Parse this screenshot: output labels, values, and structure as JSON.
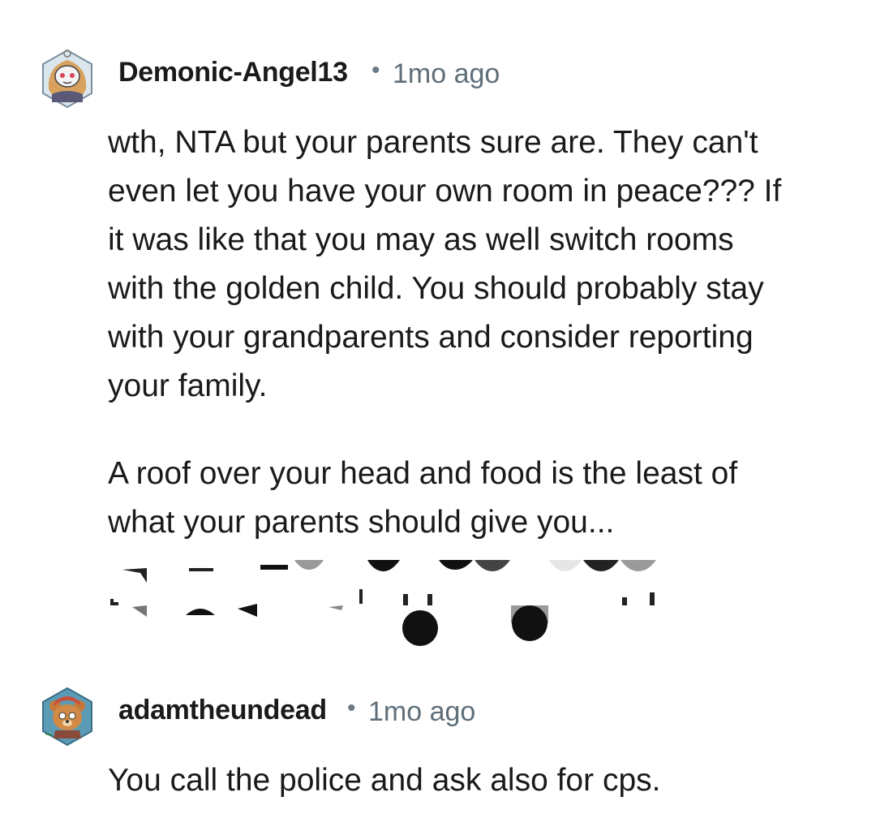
{
  "comments": [
    {
      "username": "Demonic-Angel13",
      "separator": "•",
      "timestamp": "1mo ago",
      "avatar_icon": "snoo-avatar-icon",
      "paragraphs": [
        "wth, NTA but your parents sure are. They can't\neven let you have your own room in peace??? If\nit was like that you may as well switch rooms\nwith the golden child. You should probably stay\nwith your grandparents and consider reporting\nyour family.",
        "A roof over your head and food is the least of\nwhat your parents should give you..."
      ]
    },
    {
      "username": "adamtheundead",
      "separator": "•",
      "timestamp": "1mo ago",
      "avatar_icon": "bear-avatar-icon",
      "paragraphs": [
        "You call the police and ask also for cps."
      ]
    }
  ],
  "colors": {
    "text": "#1a1a1b",
    "meta": "#5f6f7a",
    "background": "#ffffff"
  }
}
